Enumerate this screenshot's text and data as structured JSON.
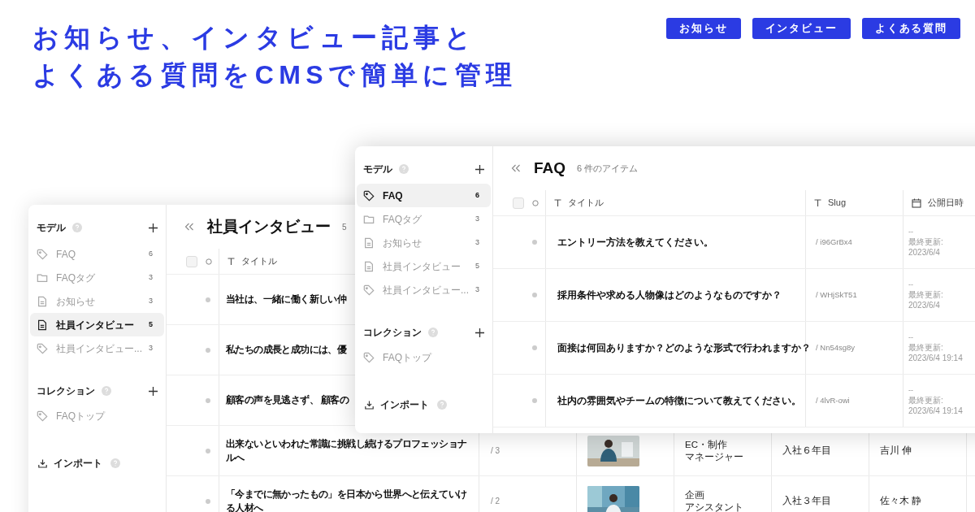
{
  "headline_lines": [
    "お知らせ、インタビュー記事と",
    "よくある質問をCMSで簡単に管理"
  ],
  "nav_buttons": [
    "お知らせ",
    "インタビュー",
    "よくある質問"
  ],
  "interview_window": {
    "sidebar": {
      "models_label": "モデル",
      "models": [
        {
          "kind": "tag",
          "label": "FAQ",
          "count": "6",
          "selected": false
        },
        {
          "kind": "folder",
          "label": "FAQタグ",
          "count": "3",
          "selected": false
        },
        {
          "kind": "document",
          "label": "お知らせ",
          "count": "3",
          "selected": false
        },
        {
          "kind": "document",
          "label": "社員インタビュー",
          "count": "5",
          "selected": true
        },
        {
          "kind": "tag",
          "label": "社員インタビュー...",
          "count": "3",
          "selected": false
        }
      ],
      "collections_label": "コレクション",
      "collections": [
        {
          "kind": "tag",
          "label": "FAQトップ"
        }
      ],
      "import_label": "インポート"
    },
    "title": "社員インタビュー",
    "item_count": "5",
    "select_all_checked": false,
    "title_column": "タイトル",
    "rows": [
      {
        "title": "当社は、一緒に働く新しい仲"
      },
      {
        "title": "私たちの成長と成功には、優"
      },
      {
        "title": "顧客の声を見逃さず、 顧客の"
      },
      {
        "title": "出来ないといわれた常識に挑戦し続けるプロフェッショナルへ",
        "slug": "/ 3",
        "photo": {
          "kind": "picture"
        },
        "role_lines": [
          "EC・制作",
          "マネージャー"
        ],
        "tenure": "入社６年目",
        "name": "吉川 伸"
      },
      {
        "title": "「今までに無かったもの」を日本から世界へと伝えていける人材へ",
        "slug": "/ 2",
        "photo": {
          "kind": "picture"
        },
        "role_lines": [
          "企画",
          "アシスタント"
        ],
        "tenure": "入社３年目",
        "name": "佐々木 静"
      }
    ]
  },
  "faq_window": {
    "sidebar": {
      "models_label": "モデル",
      "models": [
        {
          "kind": "tag",
          "label": "FAQ",
          "count": "6",
          "selected": true
        },
        {
          "kind": "folder",
          "label": "FAQタグ",
          "count": "3",
          "selected": false
        },
        {
          "kind": "document",
          "label": "お知らせ",
          "count": "3",
          "selected": false
        },
        {
          "kind": "document",
          "label": "社員インタビュー",
          "count": "5",
          "selected": false
        },
        {
          "kind": "tag",
          "label": "社員インタビュー...",
          "count": "3",
          "selected": false
        }
      ],
      "collections_label": "コレクション",
      "collections": [
        {
          "kind": "tag",
          "label": "FAQトップ"
        }
      ],
      "import_label": "インポート"
    },
    "title": "FAQ",
    "item_count": "6 件のアイテム",
    "select_all_checked": false,
    "columns": [
      {
        "kind": "text",
        "label": "タイトル"
      },
      {
        "kind": "text",
        "label": "Slug"
      },
      {
        "kind": "date",
        "label": "公開日時"
      }
    ],
    "rows": [
      {
        "title": "エントリー方法を教えてください。",
        "slug": "/ i96GrBx4",
        "date": "--",
        "updated": "最終更新: 2023/6/4"
      },
      {
        "title": "採用条件や求める人物像はどのようなものですか？",
        "slug": "/ WHjSkT51",
        "date": "--",
        "updated": "最終更新: 2023/6/4"
      },
      {
        "title": "面接は何回ありますか？どのような形式で行われますか？",
        "slug": "/ Nn54sg8y",
        "date": "--",
        "updated": "最終更新: 2023/6/4 19:14"
      },
      {
        "title": "社内の雰囲気やチームの特徴について教えてください。",
        "slug": "/ 4lvR-owi",
        "date": "--",
        "updated": "最終更新: 2023/6/4 19:14"
      }
    ]
  }
}
